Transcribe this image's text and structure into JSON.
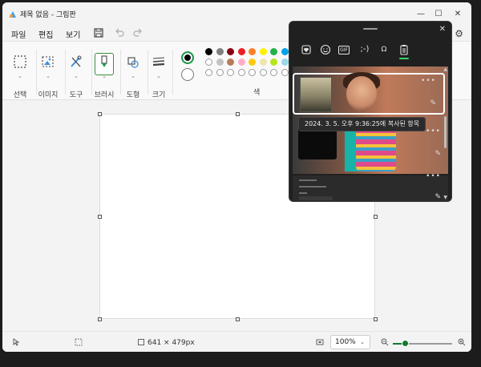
{
  "window": {
    "title": "제목 없음 - 그림판",
    "minimize_glyph": "—",
    "maximize_glyph": "☐",
    "close_glyph": "✕"
  },
  "menu": {
    "items": [
      "파일",
      "편집",
      "보기"
    ],
    "save_icon": "save-icon",
    "undo_icon": "undo-icon",
    "redo_icon": "redo-icon",
    "settings_icon": "gear-icon"
  },
  "ribbon": {
    "groups": [
      {
        "label": "선택",
        "icon": "selection-icon"
      },
      {
        "label": "이미지",
        "icon": "image-icon"
      },
      {
        "label": "도구",
        "icon": "tools-icon"
      },
      {
        "label": "브러시",
        "icon": "brush-icon"
      },
      {
        "label": "도형",
        "icon": "shapes-icon"
      },
      {
        "label": "크기",
        "icon": "size-icon"
      }
    ],
    "color_label": "색",
    "primary_color": "#000000",
    "secondary_color": "#ffffff",
    "palette_row1": [
      "#000000",
      "#7f7f7f",
      "#880015",
      "#ed1c24",
      "#ff7f27",
      "#fff200",
      "#22b14c",
      "#00a2e8"
    ],
    "palette_row2": [
      "#ffffff",
      "#c3c3c3",
      "#b97a57",
      "#ffaec9",
      "#ffc90e",
      "#efe4b0",
      "#b5e61d",
      "#99d9ea"
    ]
  },
  "statusbar": {
    "canvas_size": "641 × 479px",
    "zoom": "100%",
    "zoom_level": 0.2
  },
  "clipboard": {
    "tabs": [
      "favorites-icon",
      "emoji-icon",
      "gif-icon",
      "kaomoji-icon",
      "symbols-icon",
      "clipboard-history-icon"
    ],
    "kaomoji_text": ";-)",
    "gif_text": "GIF",
    "tooltip": "2024. 3. 5. 오후 9:36:25에 복사된 항목",
    "more_glyph": "•••",
    "pin_glyph": "📌"
  }
}
